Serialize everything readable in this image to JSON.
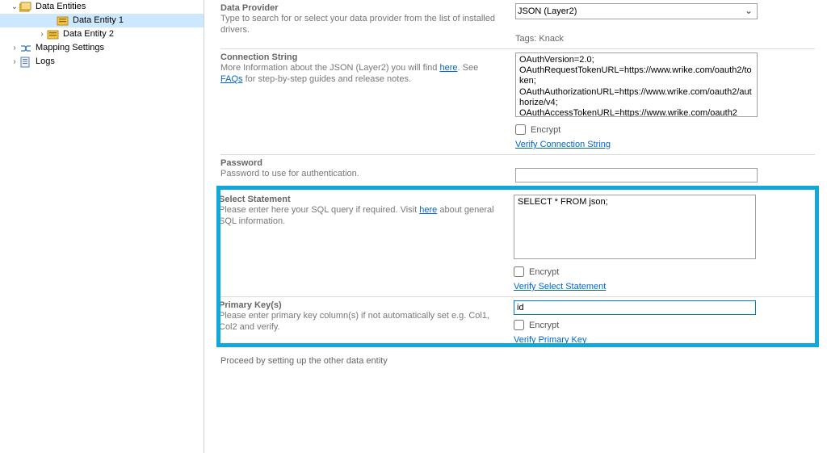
{
  "tree": {
    "root": "Data Entities",
    "entity1": "Data Entity 1",
    "entity2": "Data Entity 2",
    "mapping": "Mapping Settings",
    "logs": "Logs"
  },
  "fields": {
    "dataProvider": {
      "title": "Data Provider",
      "help": "Type to search for or select your data provider from the list of installed drivers.",
      "value": "JSON (Layer2)",
      "tagsLabel": "Tags:",
      "tagsValue": "Knack"
    },
    "connectionString": {
      "title": "Connection String",
      "helpBefore": "More Information about the JSON (Layer2) you will find ",
      "helpLink1": "here",
      "helpMid": ". See ",
      "helpLink2": "FAQs",
      "helpAfter": " for step-by-step guides and release notes.",
      "value": "OAuthVersion=2.0;\nOAuthRequestTokenURL=https://www.wrike.com/oauth2/token;\nOAuthAuthorizationURL=https://www.wrike.com/oauth2/authorize/v4;\nOAuthAccessTokenURL=https://www.wrike.com/oauth2",
      "encryptLabel": "Encrypt",
      "verify": "Verify Connection String"
    },
    "password": {
      "title": "Password",
      "help": "Password to use for authentication.",
      "value": ""
    },
    "selectStatement": {
      "title": "Select Statement",
      "helpBefore": "Please enter here your SQL query if required. Visit ",
      "helpLink": "here",
      "helpAfter": " about general SQL information.",
      "value": "SELECT * FROM json;",
      "encryptLabel": "Encrypt",
      "verify": "Verify Select Statement"
    },
    "primaryKey": {
      "title": "Primary Key(s)",
      "help": "Please enter primary key column(s) if not automatically set e.g. Col1, Col2 and verify.",
      "value": "id",
      "encryptLabel": "Encrypt",
      "verify": "Verify Primary Key"
    },
    "proceed": "Proceed by setting up the other data entity"
  }
}
